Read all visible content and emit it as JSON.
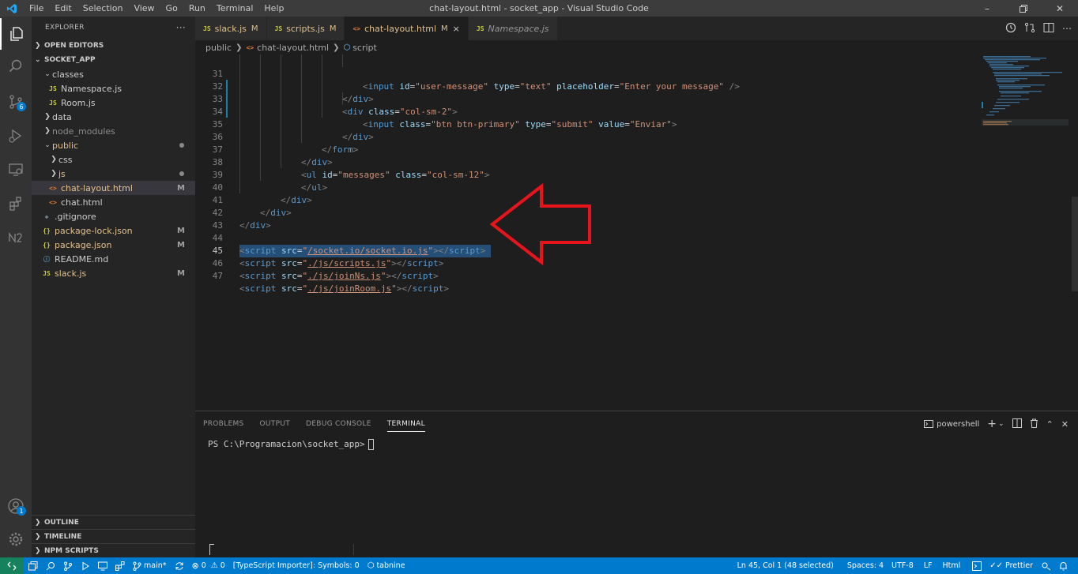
{
  "window": {
    "title": "chat-layout.html - socket_app - Visual Studio Code",
    "menu": [
      "File",
      "Edit",
      "Selection",
      "View",
      "Go",
      "Run",
      "Terminal",
      "Help"
    ]
  },
  "activity_bar": {
    "source_control_badge": "6",
    "accounts_badge": "1"
  },
  "sidebar": {
    "title": "EXPLORER",
    "more": "···",
    "open_editors": "OPEN EDITORS",
    "workspace": "SOCKET_APP",
    "tree": [
      {
        "label": "classes",
        "type": "folder",
        "open": true
      },
      {
        "label": "Namespace.js",
        "type": "js"
      },
      {
        "label": "Room.js",
        "type": "js"
      },
      {
        "label": "data",
        "type": "folder",
        "open": false
      },
      {
        "label": "node_modules",
        "type": "folder",
        "open": false
      },
      {
        "label": "public",
        "type": "folder",
        "open": true
      },
      {
        "label": "css",
        "type": "folder",
        "open": false
      },
      {
        "label": "js",
        "type": "folder",
        "open": false
      },
      {
        "label": "chat-layout.html",
        "type": "html",
        "status": "M"
      },
      {
        "label": "chat.html",
        "type": "html"
      },
      {
        "label": ".gitignore",
        "type": "git"
      },
      {
        "label": "package-lock.json",
        "type": "json",
        "status": "M"
      },
      {
        "label": "package.json",
        "type": "json",
        "status": "M"
      },
      {
        "label": "README.md",
        "type": "md"
      },
      {
        "label": "slack.js",
        "type": "js",
        "status": "M"
      }
    ],
    "outline": "OUTLINE",
    "timeline": "TIMELINE",
    "npm_scripts": "NPM SCRIPTS"
  },
  "tabs": [
    {
      "label": "slack.js",
      "icon": "JS",
      "mark": "M"
    },
    {
      "label": "scripts.js",
      "icon": "JS",
      "mark": "M"
    },
    {
      "label": "chat-layout.html",
      "icon": "<>",
      "mark": "M",
      "close": "×"
    },
    {
      "label": "Namespace.js",
      "icon": "JS"
    }
  ],
  "breadcrumb": [
    "public",
    "chat-layout.html",
    "script"
  ],
  "editor": {
    "lines": [
      {
        "n": "31"
      },
      {
        "n": "32"
      },
      {
        "n": "33"
      },
      {
        "n": "34"
      },
      {
        "n": "35"
      },
      {
        "n": "36"
      },
      {
        "n": "37"
      },
      {
        "n": "38"
      },
      {
        "n": "39"
      },
      {
        "n": "40"
      },
      {
        "n": "41"
      },
      {
        "n": "42"
      },
      {
        "n": "43"
      },
      {
        "n": "44"
      },
      {
        "n": "45"
      },
      {
        "n": "46"
      },
      {
        "n": "47"
      }
    ]
  },
  "panel": {
    "tabs": [
      "PROBLEMS",
      "OUTPUT",
      "DEBUG CONSOLE",
      "TERMINAL"
    ],
    "shell": "powershell",
    "prompt": "PS C:\\Programacion\\socket_app>"
  },
  "statusbar": {
    "branch": "main*",
    "errors": "0",
    "warnings": "0",
    "ts_importer": "[TypeScript Importer]: Symbols: 0",
    "tabnine": "tabnine",
    "position": "Ln 45, Col 1 (48 selected)",
    "spaces": "Spaces: 4",
    "encoding": "UTF-8",
    "eol": "LF",
    "language": "Html",
    "prettier": "Prettier"
  },
  "colors": {
    "accent": "#007acc",
    "annotation_arrow": "#e8141c"
  }
}
